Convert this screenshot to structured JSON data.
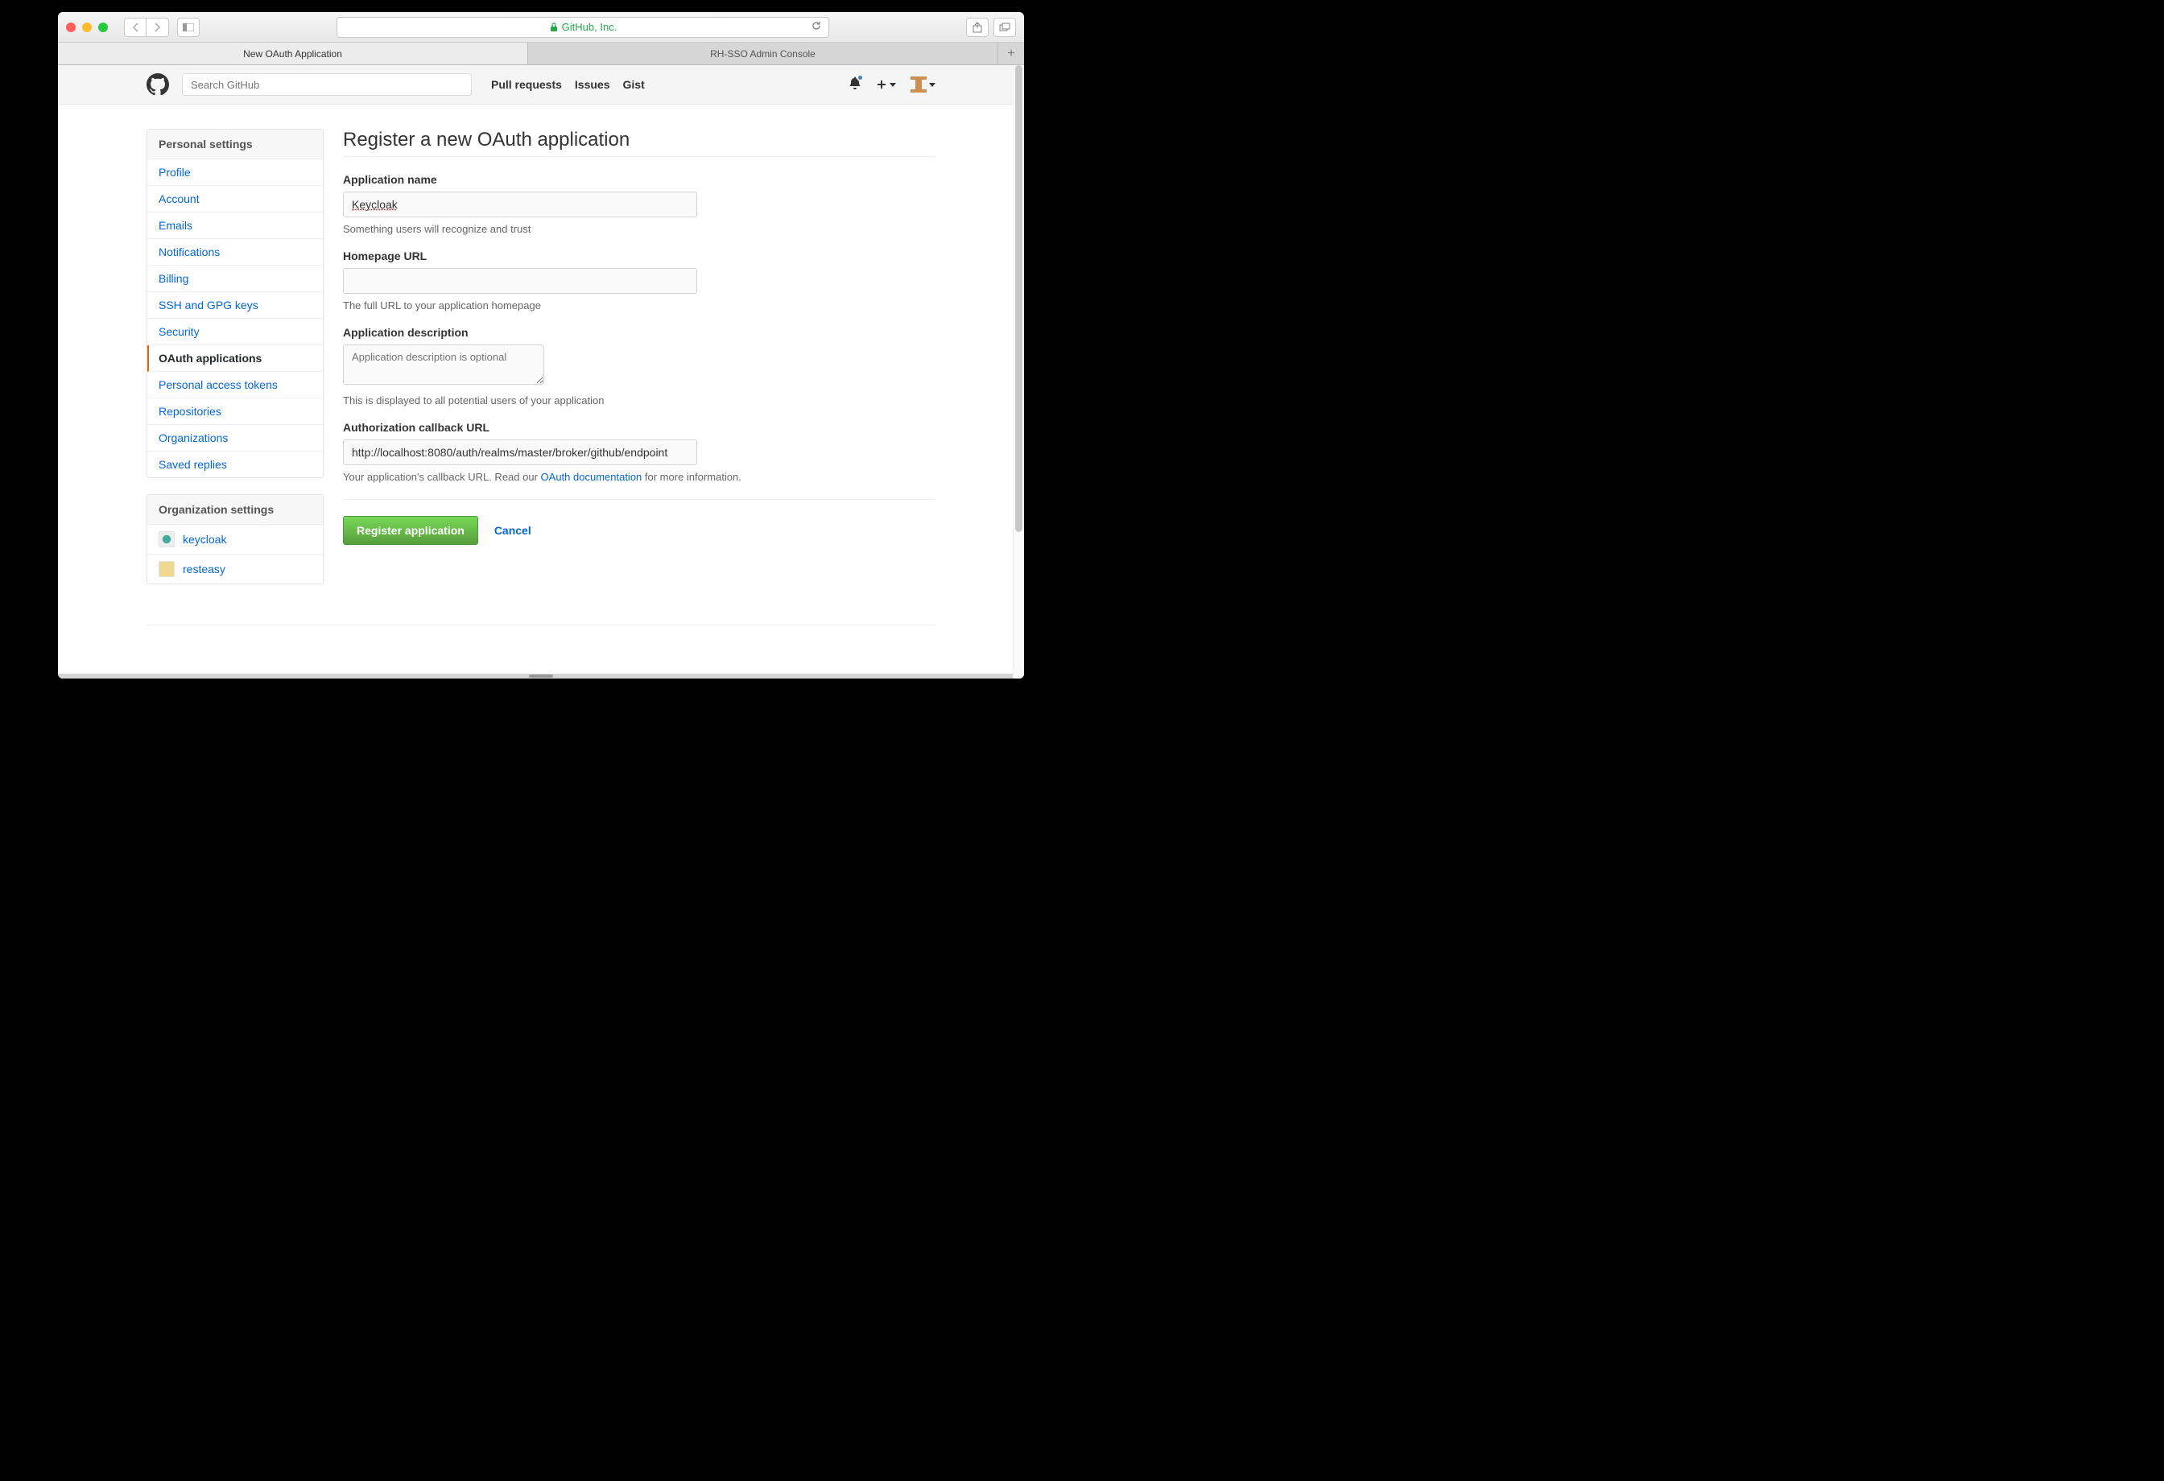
{
  "browser": {
    "url_label": "GitHub, Inc.",
    "tabs": [
      {
        "label": "New OAuth Application",
        "active": true
      },
      {
        "label": "RH-SSO Admin Console",
        "active": false
      }
    ],
    "search_placeholder": "Search GitHub",
    "nav_items": [
      "Pull requests",
      "Issues",
      "Gist"
    ]
  },
  "sidebar": {
    "personal_header": "Personal settings",
    "personal_items": [
      "Profile",
      "Account",
      "Emails",
      "Notifications",
      "Billing",
      "SSH and GPG keys",
      "Security",
      "OAuth applications",
      "Personal access tokens",
      "Repositories",
      "Organizations",
      "Saved replies"
    ],
    "active_item": "OAuth applications",
    "org_header": "Organization settings",
    "orgs": [
      "keycloak",
      "resteasy"
    ]
  },
  "form": {
    "title": "Register a new OAuth application",
    "app_name_label": "Application name",
    "app_name_value": "Keycloak",
    "app_name_note": "Something users will recognize and trust",
    "homepage_label": "Homepage URL",
    "homepage_value": "",
    "homepage_note": "The full URL to your application homepage",
    "desc_label": "Application description",
    "desc_placeholder": "Application description is optional",
    "desc_note": "This is displayed to all potential users of your application",
    "callback_label": "Authorization callback URL",
    "callback_value": "http://localhost:8080/auth/realms/master/broker/github/endpoint",
    "callback_note_pre": "Your application's callback URL. Read our ",
    "callback_note_link": "OAuth documentation",
    "callback_note_post": " for more information.",
    "submit": "Register application",
    "cancel": "Cancel"
  }
}
